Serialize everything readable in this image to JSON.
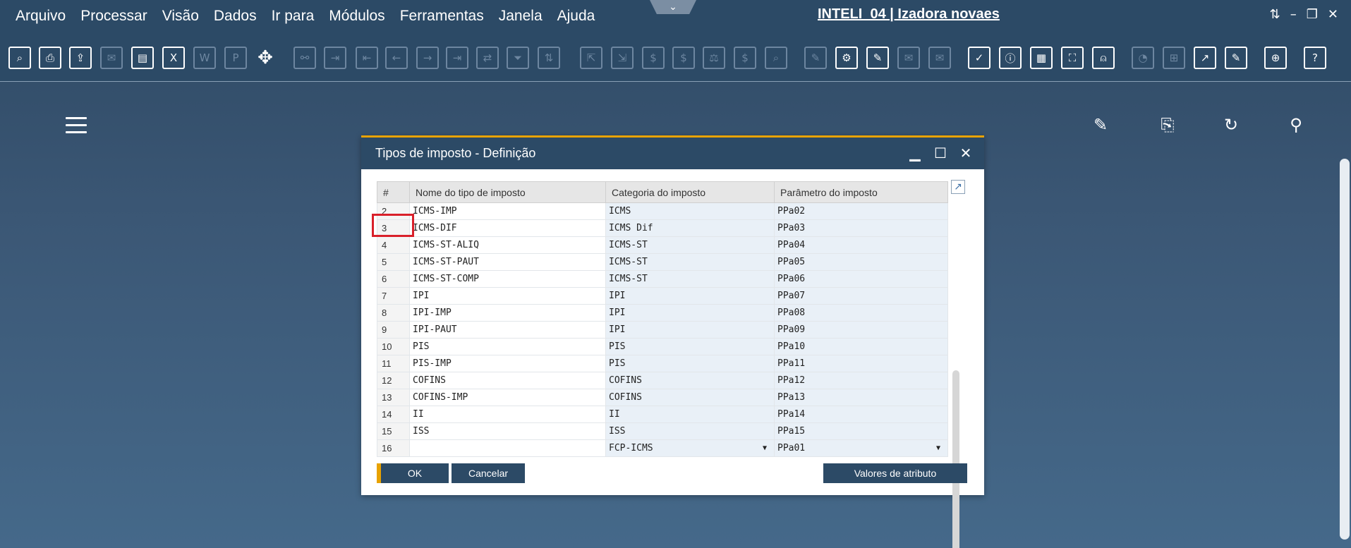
{
  "menu": {
    "items": [
      {
        "label": "Arquivo"
      },
      {
        "label": "Processar"
      },
      {
        "label": "Visão"
      },
      {
        "label": "Dados"
      },
      {
        "label": "Ir para"
      },
      {
        "label": "Módulos"
      },
      {
        "label": "Ferramentas"
      },
      {
        "label": "Janela"
      },
      {
        "label": "Ajuda"
      }
    ]
  },
  "app": {
    "title": "INTELI_04 | Izadora novaes"
  },
  "toolbar_icons": [
    "preview-icon",
    "print-icon",
    "send-icon",
    "email-icon",
    "fax-icon",
    "excel-icon",
    "word-icon",
    "pdf-icon",
    "move-icon",
    "find-icon",
    "add-icon",
    "first-record-icon",
    "previous-record-icon",
    "next-record-icon",
    "last-record-icon",
    "swap-icon",
    "filter-icon",
    "sort-icon",
    "base-document-icon",
    "target-document-icon",
    "payment-icon",
    "money-icon",
    "balance-icon",
    "journal-icon",
    "zoom-icon",
    "edit-icon",
    "settings-icon",
    "form-settings-icon",
    "message-icon",
    "alert-icon",
    "approval-icon",
    "info-icon",
    "calculator-icon",
    "network-icon",
    "user-icon",
    "dashboard-icon",
    "layout-icon",
    "export-icon",
    "report-icon",
    "web-icon",
    "help-icon"
  ],
  "dialog": {
    "title": "Tipos de imposto - Definição",
    "columns": [
      "#",
      "Nome do tipo de imposto",
      "Categoria do imposto",
      "Parâmetro do imposto"
    ],
    "rows": [
      {
        "num": "2",
        "name": "ICMS-IMP",
        "category": "ICMS",
        "param": "PPa02"
      },
      {
        "num": "3",
        "name": "ICMS-DIF",
        "category": "ICMS Dif",
        "param": "PPa03"
      },
      {
        "num": "4",
        "name": "ICMS-ST-ALIQ",
        "category": "ICMS-ST",
        "param": "PPa04"
      },
      {
        "num": "5",
        "name": "ICMS-ST-PAUT",
        "category": "ICMS-ST",
        "param": "PPa05"
      },
      {
        "num": "6",
        "name": "ICMS-ST-COMP",
        "category": "ICMS-ST",
        "param": "PPa06"
      },
      {
        "num": "7",
        "name": "IPI",
        "category": "IPI",
        "param": "PPa07"
      },
      {
        "num": "8",
        "name": "IPI-IMP",
        "category": "IPI",
        "param": "PPa08"
      },
      {
        "num": "9",
        "name": "IPI-PAUT",
        "category": "IPI",
        "param": "PPa09"
      },
      {
        "num": "10",
        "name": "PIS",
        "category": "PIS",
        "param": "PPa10"
      },
      {
        "num": "11",
        "name": "PIS-IMP",
        "category": "PIS",
        "param": "PPa11"
      },
      {
        "num": "12",
        "name": "COFINS",
        "category": "COFINS",
        "param": "PPa12"
      },
      {
        "num": "13",
        "name": "COFINS-IMP",
        "category": "COFINS",
        "param": "PPa13"
      },
      {
        "num": "14",
        "name": "II",
        "category": "II",
        "param": "PPa14"
      },
      {
        "num": "15",
        "name": "ISS",
        "category": "ISS",
        "param": "PPa15"
      },
      {
        "num": "16",
        "name": "",
        "category": "FCP-ICMS",
        "param": "PPa01"
      }
    ],
    "buttons": {
      "ok": "OK",
      "cancel": "Cancelar",
      "attributes": "Valores de atributo"
    }
  }
}
